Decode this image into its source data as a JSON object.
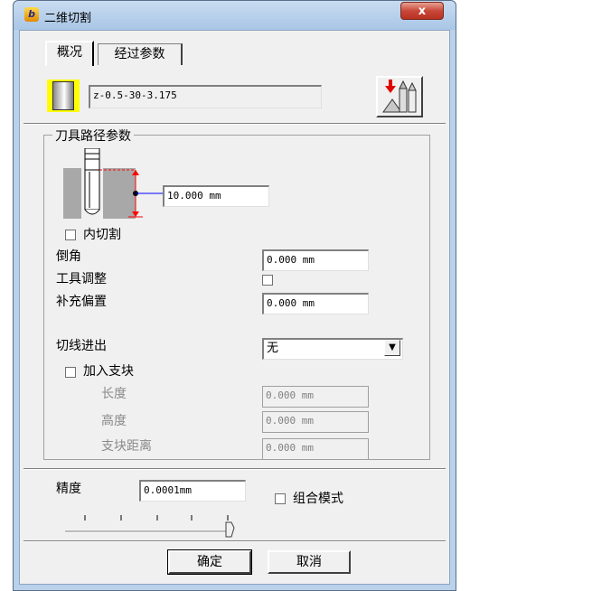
{
  "window": {
    "title": "二维切割",
    "close_label": "x",
    "app_icon_glyph": "b"
  },
  "tabs": [
    {
      "label": "概况"
    },
    {
      "label": "经过参数"
    }
  ],
  "tool": {
    "name": "z-0.5-30-3.175"
  },
  "group": {
    "title": "刀具路径参数",
    "depth_value": "10.000 mm",
    "inner_cut_label": "内切割",
    "chamfer_label": "倒角",
    "chamfer_value": "0.000 mm",
    "tool_adjust_label": "工具调整",
    "extra_offset_label": "补充偏置",
    "extra_offset_value": "0.000 mm",
    "lead_in_label": "切线进出",
    "lead_in_value": "无",
    "add_tabs_label": "加入支块",
    "length_label": "长度",
    "length_value": "0.000 mm",
    "height_label": "高度",
    "height_value": "0.000 mm",
    "tab_distance_label": "支块距离",
    "tab_distance_value": "0.000 mm"
  },
  "precision": {
    "label": "精度",
    "value": "0.0001mm",
    "combo_mode_label": "组合模式"
  },
  "buttons": {
    "ok": "确定",
    "cancel": "取消"
  },
  "colors": {
    "accent_red": "#ff0000",
    "guide_blue": "#0000ff",
    "swatch_yellow": "#ffff00"
  }
}
